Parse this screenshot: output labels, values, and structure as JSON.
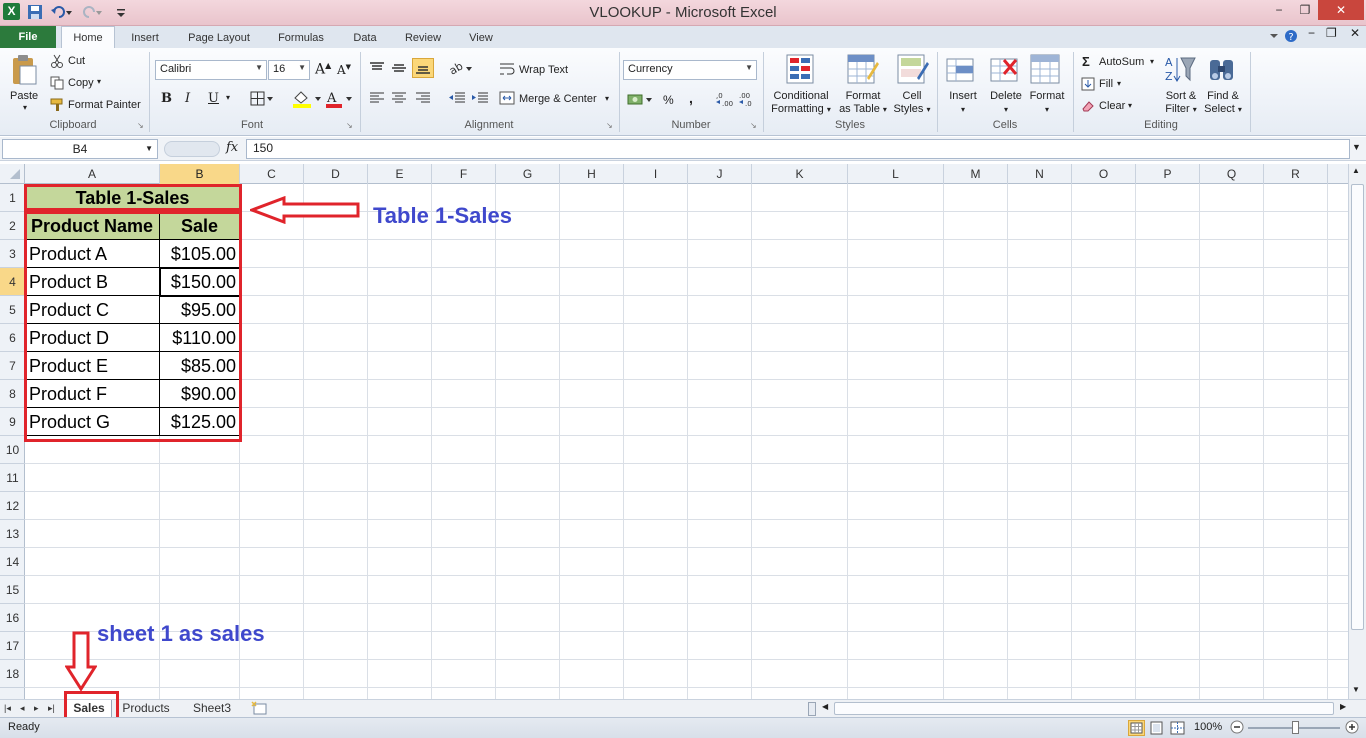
{
  "window": {
    "title": "VLOOKUP  -  Microsoft Excel",
    "minimize": "−",
    "restore": "❐",
    "close": "✕"
  },
  "quick_access": [
    "save-icon",
    "undo-icon",
    "redo-icon",
    "customize-icon"
  ],
  "tabs": [
    "File",
    "Home",
    "Insert",
    "Page Layout",
    "Formulas",
    "Data",
    "Review",
    "View"
  ],
  "ribbon": {
    "clipboard": {
      "paste": "Paste",
      "cut": "Cut",
      "copy": "Copy",
      "format_painter": "Format Painter",
      "label": "Clipboard"
    },
    "font": {
      "name": "Calibri",
      "size": "16",
      "bold": "B",
      "italic": "I",
      "underline": "U",
      "label": "Font"
    },
    "alignment": {
      "wrap": "Wrap Text",
      "merge": "Merge & Center",
      "label": "Alignment"
    },
    "number": {
      "format": "Currency",
      "pct": "%",
      "comma": ",",
      "label": "Number"
    },
    "styles": {
      "conditional": "Conditional",
      "conditional2": "Formatting",
      "format_as": "Format",
      "format_as2": "as Table",
      "cell": "Cell",
      "cell2": "Styles",
      "label": "Styles"
    },
    "cells": {
      "insert": "Insert",
      "delete": "Delete",
      "format": "Format",
      "label": "Cells"
    },
    "editing": {
      "autosum": "AutoSum",
      "fill": "Fill",
      "clear": "Clear",
      "sort": "Sort &",
      "sort2": "Filter",
      "find": "Find &",
      "find2": "Select",
      "label": "Editing"
    }
  },
  "formula_bar": {
    "name_box": "B4",
    "fx": "fx",
    "value": "150"
  },
  "columns": [
    "A",
    "B",
    "C",
    "D",
    "E",
    "F",
    "G",
    "H",
    "I",
    "J",
    "K",
    "L",
    "M",
    "N",
    "O",
    "P",
    "Q",
    "R"
  ],
  "rows": [
    "1",
    "2",
    "3",
    "4",
    "5",
    "6",
    "7",
    "8",
    "9",
    "10",
    "11",
    "12",
    "13",
    "14",
    "15",
    "16",
    "17",
    "18"
  ],
  "selected_cell": "B4",
  "table": {
    "title": "Table 1-Sales",
    "headers": [
      "Product Name",
      "Sale"
    ],
    "rows": [
      [
        "Product A",
        "$105.00"
      ],
      [
        "Product B",
        "$150.00"
      ],
      [
        "Product C",
        "$95.00"
      ],
      [
        "Product D",
        "$110.00"
      ],
      [
        "Product E",
        "$85.00"
      ],
      [
        "Product F",
        "$90.00"
      ],
      [
        "Product G",
        "$125.00"
      ]
    ],
    "header_fill": "#c4d79b"
  },
  "annotations": {
    "table_label": "Table 1-Sales",
    "sheet_label": "sheet 1 as sales",
    "color": "#3f48cc",
    "box_color": "#e0242b"
  },
  "sheets": [
    "Sales",
    "Products",
    "Sheet3"
  ],
  "active_sheet": "Sales",
  "status": {
    "ready": "Ready",
    "zoom": "100%"
  }
}
